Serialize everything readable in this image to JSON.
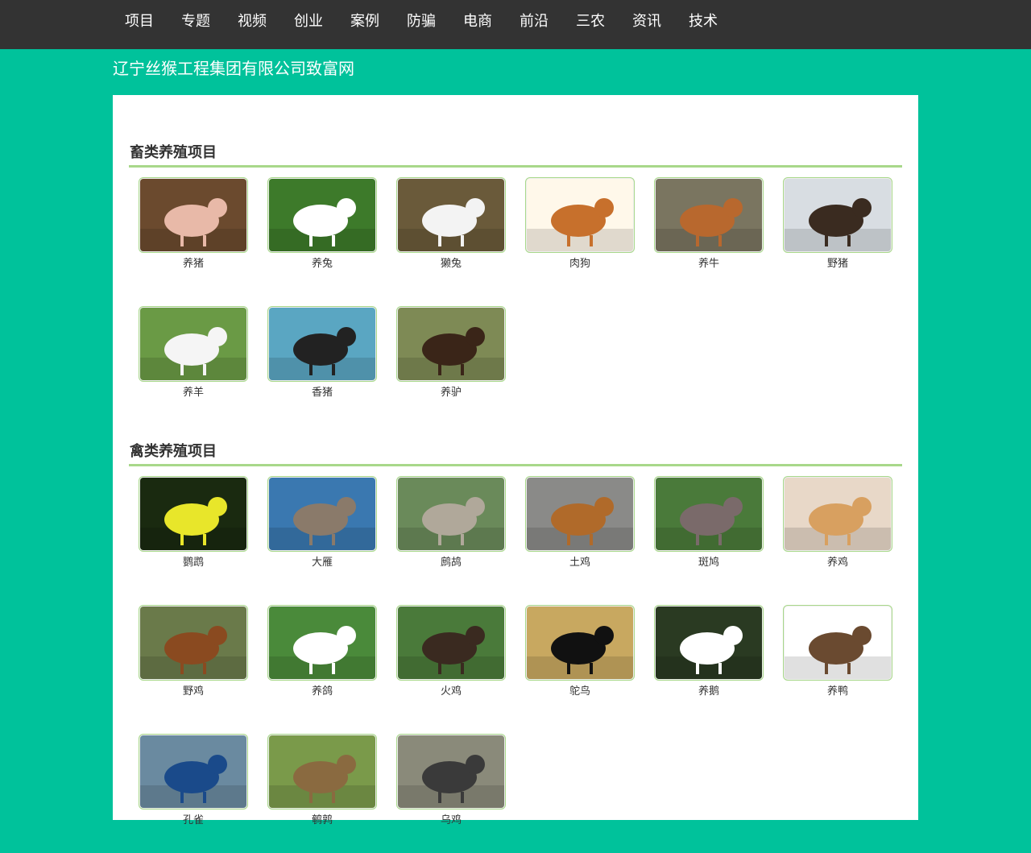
{
  "nav": {
    "items": [
      "项目",
      "专题",
      "视频",
      "创业",
      "案例",
      "防骗",
      "电商",
      "前沿",
      "三农",
      "资讯",
      "技术"
    ]
  },
  "site": {
    "title": "辽宁丝猴工程集团有限公司致富网"
  },
  "sections": [
    {
      "title": "畜类养殖项目",
      "items": [
        {
          "label": "养猪",
          "color": "#e8b9a8",
          "bg": "#6b4a2e",
          "icon": "pig-image"
        },
        {
          "label": "养兔",
          "color": "#ffffff",
          "bg": "#3d7a2a",
          "icon": "rabbit-image"
        },
        {
          "label": "獭兔",
          "color": "#f3f3f3",
          "bg": "#6a5a3a",
          "icon": "rex-rabbit-image"
        },
        {
          "label": "肉狗",
          "color": "#c7702c",
          "bg": "#fff8ea",
          "icon": "dog-image"
        },
        {
          "label": "养牛",
          "color": "#b8682e",
          "bg": "#7a7560",
          "icon": "cattle-image"
        },
        {
          "label": "野猪",
          "color": "#3a2b20",
          "bg": "#d8dde2",
          "icon": "boar-image"
        },
        {
          "label": "养羊",
          "color": "#f5f5f5",
          "bg": "#6a9a45",
          "icon": "goat-image"
        },
        {
          "label": "香猪",
          "color": "#222222",
          "bg": "#5aa6c2",
          "icon": "fragrant-pig-image"
        },
        {
          "label": "养驴",
          "color": "#3a2518",
          "bg": "#7e8a55",
          "icon": "donkey-image"
        }
      ]
    },
    {
      "title": "禽类养殖项目",
      "items": [
        {
          "label": "鹦鹉",
          "color": "#e8e62a",
          "bg": "#1a2a10",
          "icon": "parrot-image"
        },
        {
          "label": "大雁",
          "color": "#8a7a6a",
          "bg": "#3a78b0",
          "icon": "goose-image"
        },
        {
          "label": "鹧鸪",
          "color": "#b0a89a",
          "bg": "#6a8a5a",
          "icon": "partridge-image"
        },
        {
          "label": "土鸡",
          "color": "#b06a2a",
          "bg": "#8a8a88",
          "icon": "native-chicken-image"
        },
        {
          "label": "斑鸠",
          "color": "#7a6a6a",
          "bg": "#4a7a3a",
          "icon": "dove-image"
        },
        {
          "label": "养鸡",
          "color": "#d8a060",
          "bg": "#e8d8c8",
          "icon": "chicken-image"
        },
        {
          "label": "野鸡",
          "color": "#8a4a20",
          "bg": "#6a7a4a",
          "icon": "pheasant-image"
        },
        {
          "label": "养鸽",
          "color": "#ffffff",
          "bg": "#4a8a3a",
          "icon": "pigeon-image"
        },
        {
          "label": "火鸡",
          "color": "#3a2a20",
          "bg": "#4a7a3a",
          "icon": "turkey-image"
        },
        {
          "label": "鸵鸟",
          "color": "#111111",
          "bg": "#c8a860",
          "icon": "ostrich-image"
        },
        {
          "label": "养鹅",
          "color": "#ffffff",
          "bg": "#2a3a22",
          "icon": "white-goose-image"
        },
        {
          "label": "养鸭",
          "color": "#6a4a30",
          "bg": "#ffffff",
          "icon": "duck-image"
        },
        {
          "label": "孔雀",
          "color": "#1a4a8a",
          "bg": "#6a8aa0",
          "icon": "peacock-image"
        },
        {
          "label": "鹌鹑",
          "color": "#8a6a40",
          "bg": "#7a9a4a",
          "icon": "quail-image"
        },
        {
          "label": "乌鸡",
          "color": "#3a3a3a",
          "bg": "#8a8a7a",
          "icon": "silkie-image"
        }
      ]
    }
  ]
}
